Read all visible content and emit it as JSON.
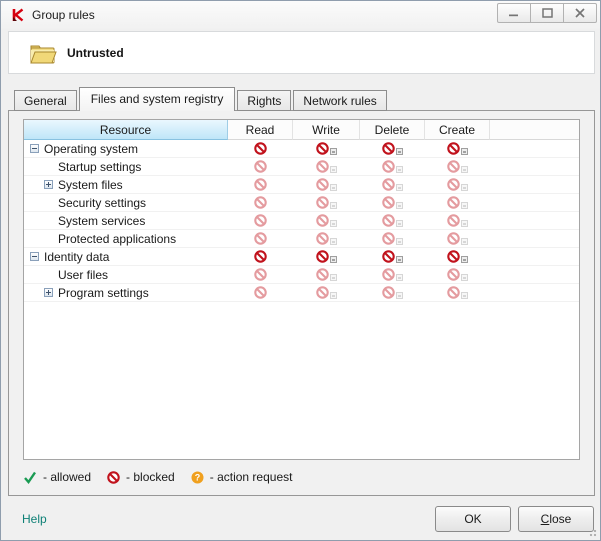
{
  "window": {
    "title": "Group rules",
    "controls": [
      {
        "name": "minimize"
      },
      {
        "name": "maximize"
      },
      {
        "name": "close"
      }
    ]
  },
  "banner": {
    "group_name": "Untrusted"
  },
  "tabs": [
    {
      "label": "General",
      "active": false
    },
    {
      "label": "Files and system registry",
      "active": true
    },
    {
      "label": "Rights",
      "active": false
    },
    {
      "label": "Network rules",
      "active": false
    }
  ],
  "table": {
    "columns": [
      "Resource",
      "Read",
      "Write",
      "Delete",
      "Create"
    ],
    "rows": [
      {
        "label": "Operating system",
        "level": 0,
        "expander": "collapse",
        "icon_emphasis": "strong",
        "cells": {
          "read": "blocked",
          "write": "blocked-log",
          "delete": "blocked-log",
          "create": "blocked-log"
        }
      },
      {
        "label": "Startup settings",
        "level": 1,
        "expander": "none",
        "icon_emphasis": "faded",
        "cells": {
          "read": "blocked",
          "write": "blocked-log",
          "delete": "blocked-log",
          "create": "blocked-log"
        }
      },
      {
        "label": "System files",
        "level": 1,
        "expander": "expand",
        "icon_emphasis": "faded",
        "cells": {
          "read": "blocked",
          "write": "blocked-log",
          "delete": "blocked-log",
          "create": "blocked-log"
        }
      },
      {
        "label": "Security settings",
        "level": 1,
        "expander": "none",
        "icon_emphasis": "faded",
        "cells": {
          "read": "blocked",
          "write": "blocked-log",
          "delete": "blocked-log",
          "create": "blocked-log"
        }
      },
      {
        "label": "System services",
        "level": 1,
        "expander": "none",
        "icon_emphasis": "faded",
        "cells": {
          "read": "blocked",
          "write": "blocked-log",
          "delete": "blocked-log",
          "create": "blocked-log"
        }
      },
      {
        "label": "Protected applications",
        "level": 1,
        "expander": "none",
        "icon_emphasis": "faded",
        "cells": {
          "read": "blocked",
          "write": "blocked-log",
          "delete": "blocked-log",
          "create": "blocked-log"
        }
      },
      {
        "label": "Identity data",
        "level": 0,
        "expander": "collapse",
        "icon_emphasis": "strong",
        "cells": {
          "read": "blocked",
          "write": "blocked-log",
          "delete": "blocked-log",
          "create": "blocked-log"
        }
      },
      {
        "label": "User files",
        "level": 1,
        "expander": "none",
        "icon_emphasis": "faded",
        "cells": {
          "read": "blocked",
          "write": "blocked-log",
          "delete": "blocked-log",
          "create": "blocked-log"
        }
      },
      {
        "label": "Program settings",
        "level": 1,
        "expander": "expand",
        "icon_emphasis": "faded",
        "cells": {
          "read": "blocked",
          "write": "blocked-log",
          "delete": "blocked-log",
          "create": "blocked-log"
        }
      }
    ]
  },
  "legend": [
    {
      "icon": "check-icon",
      "label": "- allowed"
    },
    {
      "icon": "blocked-icon",
      "label": "- blocked"
    },
    {
      "icon": "question-icon",
      "label": "- action request"
    }
  ],
  "footer": {
    "help_label": "Help",
    "ok_label": "OK",
    "close_label": "Close"
  },
  "colors": {
    "blocked_red": "#c1121c",
    "allowed_green": "#1a9b53",
    "action_request_orange": "#f0a01e",
    "header_highlight": "#bfe6f8",
    "help_link": "#0e8076",
    "brand_red": "#d6000f"
  }
}
